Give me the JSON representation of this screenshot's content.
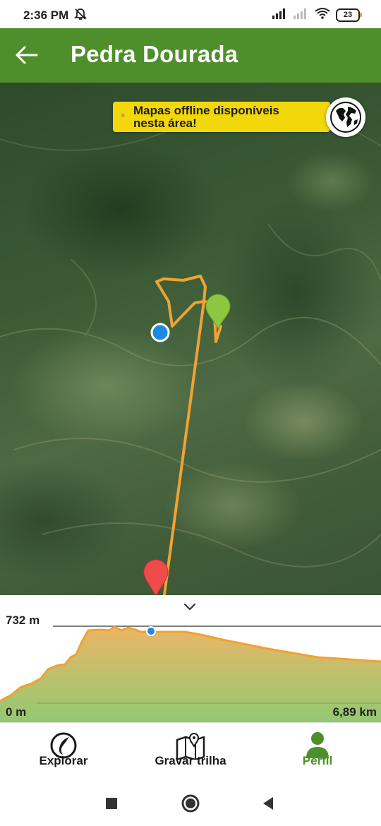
{
  "status_bar": {
    "time": "2:36 PM",
    "battery_level": "23"
  },
  "header": {
    "title": "Pedra Dourada"
  },
  "map": {
    "offline_banner": {
      "close_label": "×",
      "text": "Mapas offline disponíveis\nnesta área!"
    }
  },
  "elevation": {
    "max_label": "732 m",
    "min_label": "0 m",
    "distance_label": "6,89 km"
  },
  "bottom_nav": {
    "items": [
      {
        "label": "Explorar",
        "icon": "explore-icon",
        "active": false
      },
      {
        "label": "Gravar trilha",
        "icon": "map-pin-icon",
        "active": false
      },
      {
        "label": "Perfil",
        "icon": "profile-icon",
        "active": true
      }
    ]
  },
  "colors": {
    "brand_green": "#4f8f2b",
    "banner_yellow": "#f2d70a",
    "route_orange": "#f0a232",
    "start_marker": "#8dc63f",
    "end_marker": "#ef4b4b",
    "position_dot": "#1e88e5"
  }
}
